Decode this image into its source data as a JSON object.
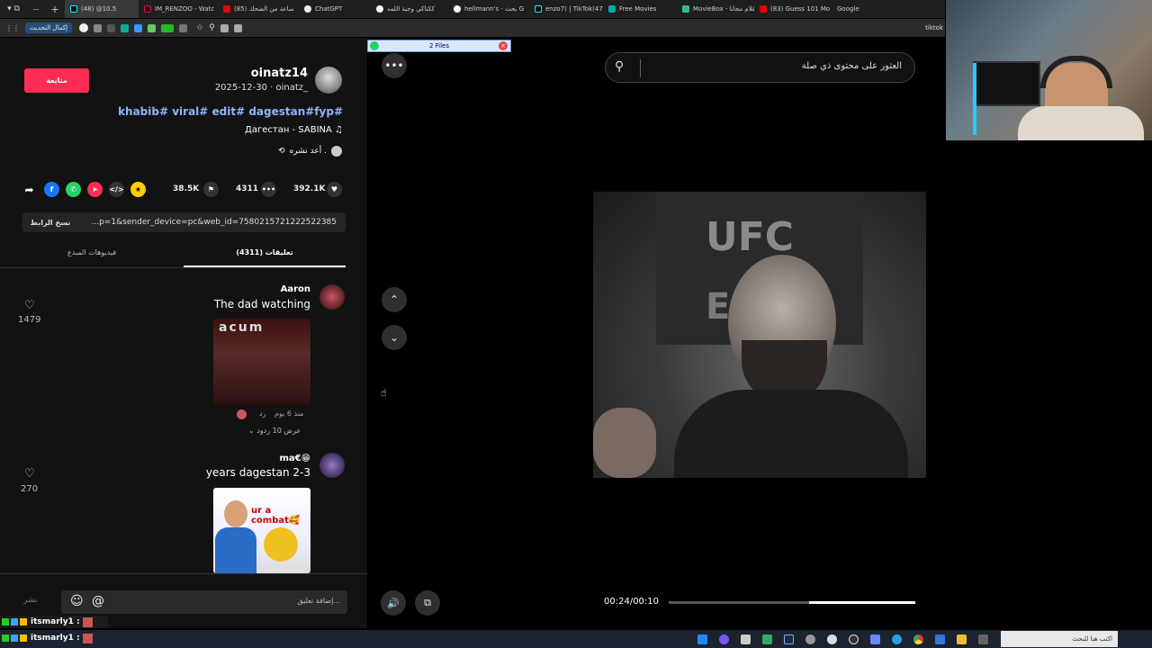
{
  "browser": {
    "tabs": [
      {
        "label": "(48) ‎@10.5",
        "color": "#000"
      },
      {
        "label": "IM_RENZOO - Watc",
        "color": "#000"
      },
      {
        "label": "(85) ساعة من الضحك",
        "color": "#f00"
      },
      {
        "label": "ChatGPT",
        "color": "#fff"
      },
      {
        "label": "ككتاكي وجبة اللمه",
        "color": "#fff"
      },
      {
        "label": "hellmann's - بحث G",
        "color": "#fff"
      },
      {
        "label": "enzo7) | TikTok(47)",
        "color": "#000"
      },
      {
        "label": "Free Movies",
        "color": "#0aa"
      },
      {
        "label": "MovieBox - الأفلام مجانا",
        "color": "#3b8"
      },
      {
        "label": "(83) Guess 101 Mo",
        "color": "#f00"
      },
      {
        "label": "Google",
        "color": "#fff"
      }
    ],
    "update_button": "إكمال التحديث",
    "tiktok_partial": "tiktok"
  },
  "files_popup": "2 Files",
  "post": {
    "username": "oinatz14",
    "meta": "2025-12-30 · oinatz_",
    "follow_label": "متابعة",
    "hashtags": "khabib# viral# edit# dagestan#fyp#",
    "music": "Дагестан - SABINA",
    "repost_label": "أعد نشره .",
    "likes": "392.1K",
    "comments": "4311",
    "saves": "38.5K",
    "link": "...p=1&sender_device=pc&web_id=7580215721222522385",
    "copy_link_label": "نسخ الرابط",
    "tab_comments": "تعليقات (4311)",
    "tab_videos": "فيديوهات المبدع"
  },
  "comments": [
    {
      "user": "Aaron",
      "text": "The dad watching",
      "likes": "1479",
      "age": "منذ 6 يوم",
      "reply": "رد",
      "replies": "عرض 10 ردود",
      "image_text": "acum"
    },
    {
      "user": "ma€😁",
      "text": "years dagestan 2-3",
      "likes": "270",
      "image_text": "ur a combat🥰"
    }
  ],
  "composer": {
    "placeholder": "إضافة تعليق...",
    "post_label": "نشر"
  },
  "search": {
    "placeholder": "العثور على محتوى ذي صلة"
  },
  "player": {
    "time": "00:24/00:10",
    "progress": 0.43
  },
  "chat_overlay": [
    {
      "user": "itsmarly1 :"
    },
    {
      "user": "itsmarly1 :"
    }
  ],
  "taskbar": {
    "search_placeholder": "اكتب هنا للبحث"
  },
  "colors": {
    "accent": "#fe2c55",
    "hashtag": "#8fb4ff"
  }
}
